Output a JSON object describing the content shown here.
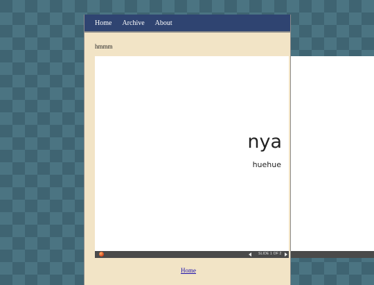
{
  "nav": {
    "items": [
      "Home",
      "Archive",
      "About"
    ]
  },
  "post": {
    "caption": "hmmm"
  },
  "slide": {
    "title": "nya",
    "subtitle": "huehue",
    "counter": "SLIDE 1 OF 2"
  },
  "footer": {
    "home_label": "Home"
  }
}
